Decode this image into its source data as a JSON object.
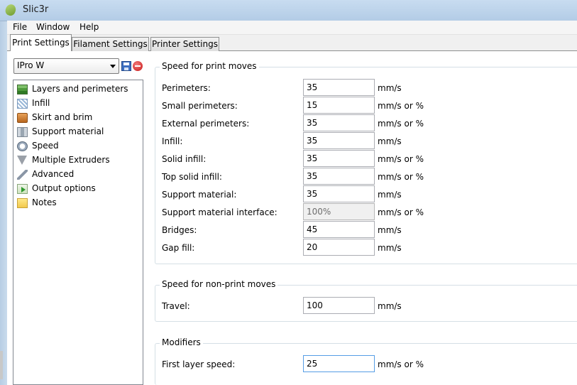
{
  "window": {
    "title": "Slic3r"
  },
  "menu": [
    "File",
    "Window",
    "Help"
  ],
  "tabs": [
    "Print Settings",
    "Filament Settings",
    "Printer Settings"
  ],
  "preset": {
    "selected": "IPro W"
  },
  "tree": [
    {
      "label": "Layers and perimeters",
      "icon": "layers-icon"
    },
    {
      "label": "Infill",
      "icon": "infill-icon"
    },
    {
      "label": "Skirt and brim",
      "icon": "skirt-icon"
    },
    {
      "label": "Support material",
      "icon": "support-icon"
    },
    {
      "label": "Speed",
      "icon": "speed-icon"
    },
    {
      "label": "Multiple Extruders",
      "icon": "extruder-funnel-icon"
    },
    {
      "label": "Advanced",
      "icon": "wrench-icon"
    },
    {
      "label": "Output options",
      "icon": "output-icon"
    },
    {
      "label": "Notes",
      "icon": "note-icon"
    }
  ],
  "print_moves": {
    "title": "Speed for print moves",
    "rows": [
      {
        "label": "Perimeters:",
        "value": "35",
        "unit": "mm/s"
      },
      {
        "label": "Small perimeters:",
        "value": "15",
        "unit": "mm/s or %"
      },
      {
        "label": "External perimeters:",
        "value": "35",
        "unit": "mm/s or %"
      },
      {
        "label": "Infill:",
        "value": "35",
        "unit": "mm/s"
      },
      {
        "label": "Solid infill:",
        "value": "35",
        "unit": "mm/s or %"
      },
      {
        "label": "Top solid infill:",
        "value": "35",
        "unit": "mm/s or %"
      },
      {
        "label": "Support material:",
        "value": "35",
        "unit": "mm/s"
      },
      {
        "label": "Support material interface:",
        "value": "100%",
        "unit": "mm/s or %",
        "disabled": true
      },
      {
        "label": "Bridges:",
        "value": "45",
        "unit": "mm/s"
      },
      {
        "label": "Gap fill:",
        "value": "20",
        "unit": "mm/s"
      }
    ]
  },
  "non_print_moves": {
    "title": "Speed for non-print moves",
    "rows": [
      {
        "label": "Travel:",
        "value": "100",
        "unit": "mm/s"
      }
    ]
  },
  "modifiers": {
    "title": "Modifiers",
    "rows": [
      {
        "label": "First layer speed:",
        "value": "25",
        "unit": "mm/s or %",
        "focused": true
      }
    ]
  }
}
